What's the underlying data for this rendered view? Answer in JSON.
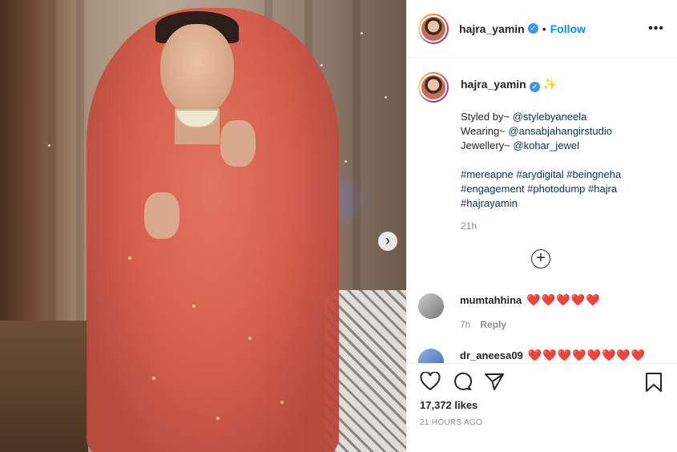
{
  "post": {
    "username": "hajra_yamin",
    "separator": "•",
    "follow_label": "Follow",
    "more_label": "•••",
    "next_label": "›"
  },
  "caption": {
    "username": "hajra_yamin",
    "sparkle": "✨",
    "lines": [
      {
        "prefix": "Styled by~ ",
        "link": "@stylebyaneela"
      },
      {
        "prefix": "Wearing~ ",
        "link": "@ansabjahangirstudio"
      },
      {
        "prefix": "Jewellery~ ",
        "link": "@kohar_jewel"
      }
    ],
    "hashtags_line1": "#mereapne #arydigital #beingneha",
    "hashtags_line2": "#engagement #photodump #hajra",
    "hashtags_line3": "#hajrayamin",
    "time": "21h"
  },
  "load_more": "+",
  "comments": [
    {
      "user": "mumtahhina",
      "text": "❤️❤️❤️❤️❤️",
      "time": "7h",
      "reply": "Reply"
    },
    {
      "user": "dr_aneesa09",
      "text": "❤️❤️❤️❤️❤️❤️❤️❤️"
    }
  ],
  "likes": "17,372 likes",
  "posted_ago": "21 HOURS AGO",
  "icons": [
    "heart-icon",
    "comment-icon",
    "share-icon",
    "bookmark-icon",
    "verified-icon",
    "more-icon"
  ],
  "colors": {
    "accent": "#0095f6",
    "link": "#00376b",
    "heart": "#e0142a",
    "muted": "#8e8e8e"
  }
}
